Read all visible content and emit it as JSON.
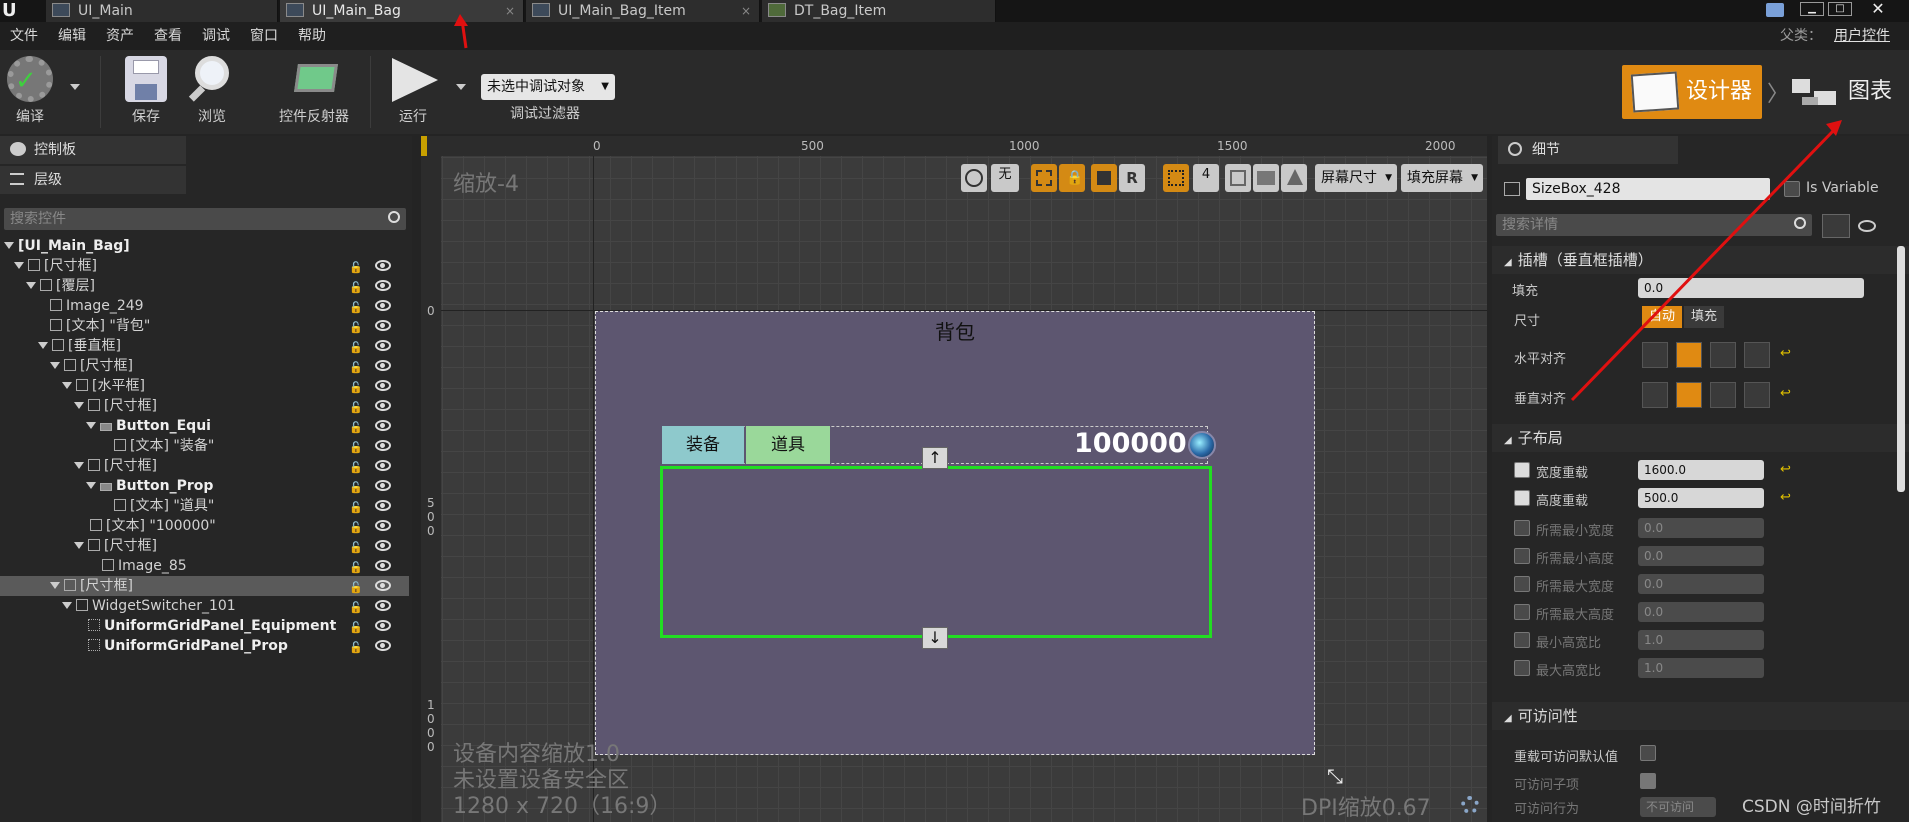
{
  "tabs": [
    {
      "label": "UI_Main"
    },
    {
      "label": "UI_Main_Bag"
    },
    {
      "label": "UI_Main_Bag_Item"
    },
    {
      "label": "DT_Bag_Item"
    }
  ],
  "menu": [
    "文件",
    "编辑",
    "资产",
    "查看",
    "调试",
    "窗口",
    "帮助"
  ],
  "parent_class": {
    "label": "父类：",
    "value": "用户控件"
  },
  "toolbar": {
    "compile": "编译",
    "save": "保存",
    "browse": "浏览",
    "reflect": "控件反射器",
    "run": "运行",
    "debug_target": "未选中调试对象",
    "debug_filter": "调试过滤器"
  },
  "mode_switch": {
    "designer": "设计器",
    "graph": "图表"
  },
  "left_panel": {
    "palette_tab": "控制板",
    "hierarchy_tab": "层级",
    "search_placeholder": "搜索控件"
  },
  "hierarchy": [
    {
      "label": "[UI_Main_Bag]",
      "bold": true
    },
    {
      "label": "[尺寸框]"
    },
    {
      "label": "[覆层]"
    },
    {
      "label": "Image_249"
    },
    {
      "label": "[文本] \"背包\""
    },
    {
      "label": "[垂直框]"
    },
    {
      "label": "[尺寸框]"
    },
    {
      "label": "[水平框]"
    },
    {
      "label": "[尺寸框]"
    },
    {
      "label": "Button_Equi",
      "bold": true
    },
    {
      "label": "[文本] \"装备\""
    },
    {
      "label": "[尺寸框]"
    },
    {
      "label": "Button_Prop",
      "bold": true
    },
    {
      "label": "[文本] \"道具\""
    },
    {
      "label": "[文本] \"100000\""
    },
    {
      "label": "[尺寸框]"
    },
    {
      "label": "Image_85"
    },
    {
      "label": "[尺寸框]",
      "selected": true
    },
    {
      "label": "WidgetSwitcher_101"
    },
    {
      "label": "UniformGridPanel_Equipment",
      "bold": true
    },
    {
      "label": "UniformGridPanel_Prop",
      "bold": true
    }
  ],
  "canvas": {
    "zoom": "缩放-4",
    "ruler_x": [
      "0",
      "500",
      "1000",
      "1500",
      "2000"
    ],
    "ruler_y": [
      "0",
      "5\n0\n0",
      "1\n0\n0\n0"
    ],
    "none_label": "无",
    "r_label": "R",
    "grid_num": "4",
    "screen_size": "屏幕尺寸",
    "fill_screen": "填充屏幕",
    "widget_title": "背包",
    "btn_equip": "装备",
    "btn_prop": "道具",
    "money": "100000",
    "info_line1": "设备内容缩放1.0",
    "info_line2": "未设置设备安全区",
    "info_line3": "1280 x 720（16:9）",
    "dpi": "DPI缩放0.67"
  },
  "details": {
    "tab": "细节",
    "name": "SizeBox_428",
    "is_variable": "Is Variable",
    "search_placeholder": "搜索详情",
    "slot_section": "插槽（垂直框插槽）",
    "padding": "填充",
    "padding_value": "0.0",
    "size": "尺寸",
    "size_auto": "自动",
    "size_fill": "填充",
    "h_align": "水平对齐",
    "v_align": "垂直对齐",
    "child_layout": "子布局",
    "width_override": "宽度重载",
    "width_value": "1600.0",
    "height_override": "高度重载",
    "height_value": "500.0",
    "min_desired_width": "所需最小宽度",
    "min_desired_height": "所需最小高度",
    "max_desired_width": "所需最大宽度",
    "max_desired_height": "所需最大高度",
    "min_aspect": "最小高宽比",
    "max_aspect": "最大高宽比",
    "zero": "0.0",
    "one": "1.0",
    "accessibility": "可访问性",
    "override_access": "重载可访问默认值",
    "access_children": "可访问子项",
    "access_behavior": "可访问行为",
    "access_behavior_value": "不可访问"
  },
  "watermark": "CSDN @时间折竹",
  "colors": {
    "accent": "#e08a12",
    "canvas_widget": "#5d5670",
    "selection": "#22dd22"
  }
}
